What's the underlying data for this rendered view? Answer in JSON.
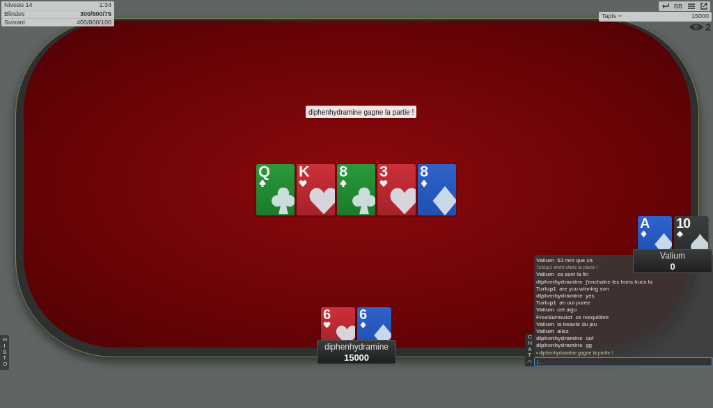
{
  "level_info": [
    {
      "label": "Niveau 14",
      "value": "1:34",
      "bold": false
    },
    {
      "label": "Blindes",
      "value": "300/600/75",
      "bold": true
    },
    {
      "label": "Suivant",
      "value": "400/800/100",
      "bold": false
    }
  ],
  "toolbar": {
    "bb_label": "BB"
  },
  "stack_bar": {
    "label": "Tapis ~",
    "value": "15000"
  },
  "spectators": "2",
  "announcement": "diphenhydramine gagne la partie !",
  "board": [
    {
      "rank": "Q",
      "kind": "clubs"
    },
    {
      "rank": "K",
      "kind": "hearts"
    },
    {
      "rank": "8",
      "kind": "clubs"
    },
    {
      "rank": "3",
      "kind": "hearts"
    },
    {
      "rank": "8",
      "kind": "diamonds"
    }
  ],
  "seats": [
    {
      "name": "diphenhydramine",
      "stack": "15000",
      "cards": [
        {
          "rank": "6",
          "kind": "hearts"
        },
        {
          "rank": "6",
          "kind": "diamonds"
        }
      ]
    },
    {
      "name": "Valium",
      "stack": "0",
      "cards": [
        {
          "rank": "A",
          "kind": "diamonds"
        },
        {
          "rank": "10",
          "kind": "spades"
        }
      ]
    }
  ],
  "histo_tab": "HISTO",
  "chat": {
    "tab": "CHAT",
    "placeholder": "|...",
    "messages": [
      {
        "kind": "message",
        "author": "Valium",
        "text": "63 rien que ca"
      },
      {
        "kind": "system",
        "text": "Turlup1 entre dans la place !"
      },
      {
        "kind": "message",
        "author": "Valium",
        "text": "ca sent la fin"
      },
      {
        "kind": "message",
        "author": "diphenhydramine",
        "text": "j'enchaine les bons trucs la"
      },
      {
        "kind": "message",
        "author": "Turlup1",
        "text": "are you winning son"
      },
      {
        "kind": "message",
        "author": "diphenhydramine",
        "text": "yes"
      },
      {
        "kind": "message",
        "author": "Turlup1",
        "text": "ah oui purée"
      },
      {
        "kind": "message",
        "author": "Valium",
        "text": "cet algo"
      },
      {
        "kind": "message",
        "author": "FreeSurmulot",
        "text": "ce reequilibre"
      },
      {
        "kind": "message",
        "author": "Valium",
        "text": "la beauté du jeu"
      },
      {
        "kind": "message",
        "author": "Valium",
        "text": "allez"
      },
      {
        "kind": "message",
        "author": "diphenhydramine",
        "text": "ouf"
      },
      {
        "kind": "message",
        "author": "diphenhydramine",
        "text": "gg"
      },
      {
        "kind": "event",
        "text": "• diphenhydramine gagne la partie !"
      }
    ]
  }
}
